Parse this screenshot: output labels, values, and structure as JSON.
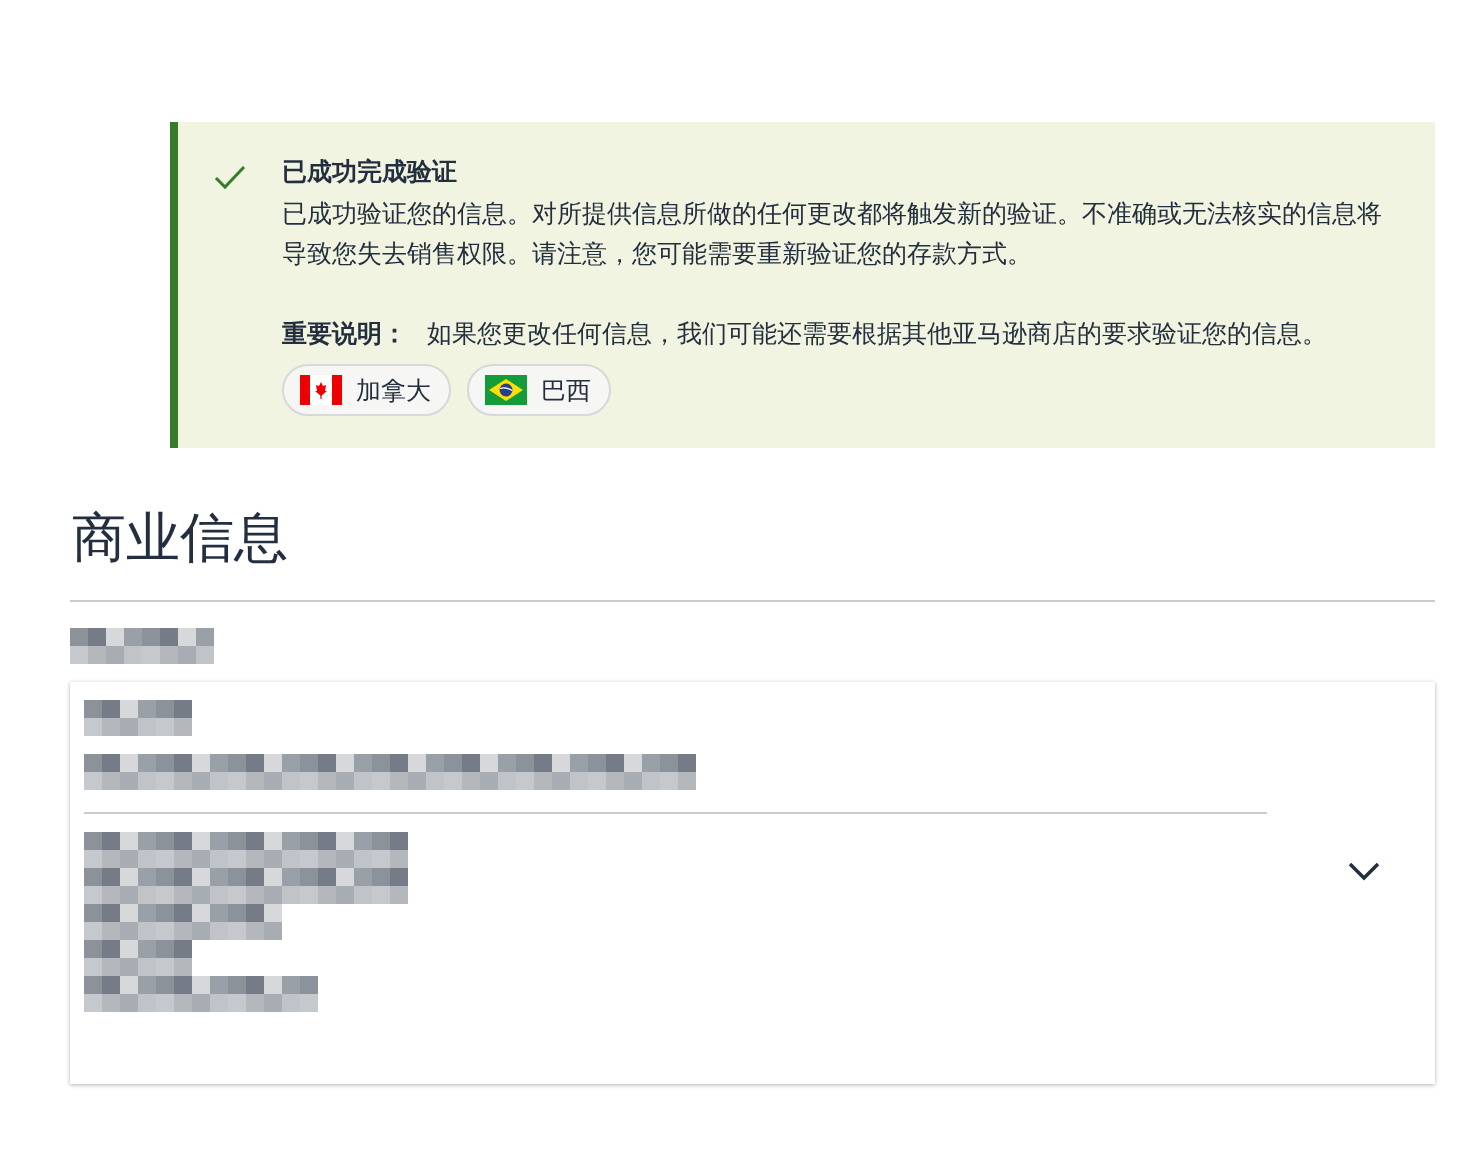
{
  "alert": {
    "title": "已成功完成验证",
    "message": "已成功验证您的信息。对所提供信息所做的任何更改都将触发新的验证。不准确或无法核实的信息将导致您失去销售权限。请注意，您可能需要重新验证您的存款方式。",
    "note": "**重要说明：** 如果您更改任何信息，我们可能还需要根据其他亚马逊商店的要求验证您的信息。",
    "stores": [
      {
        "kind": "canada",
        "label": "加拿大"
      },
      {
        "kind": "brazil",
        "label": "巴西"
      }
    ]
  },
  "section": {
    "title": "商业信息",
    "details_card": {
      "expanded": false
    }
  }
}
